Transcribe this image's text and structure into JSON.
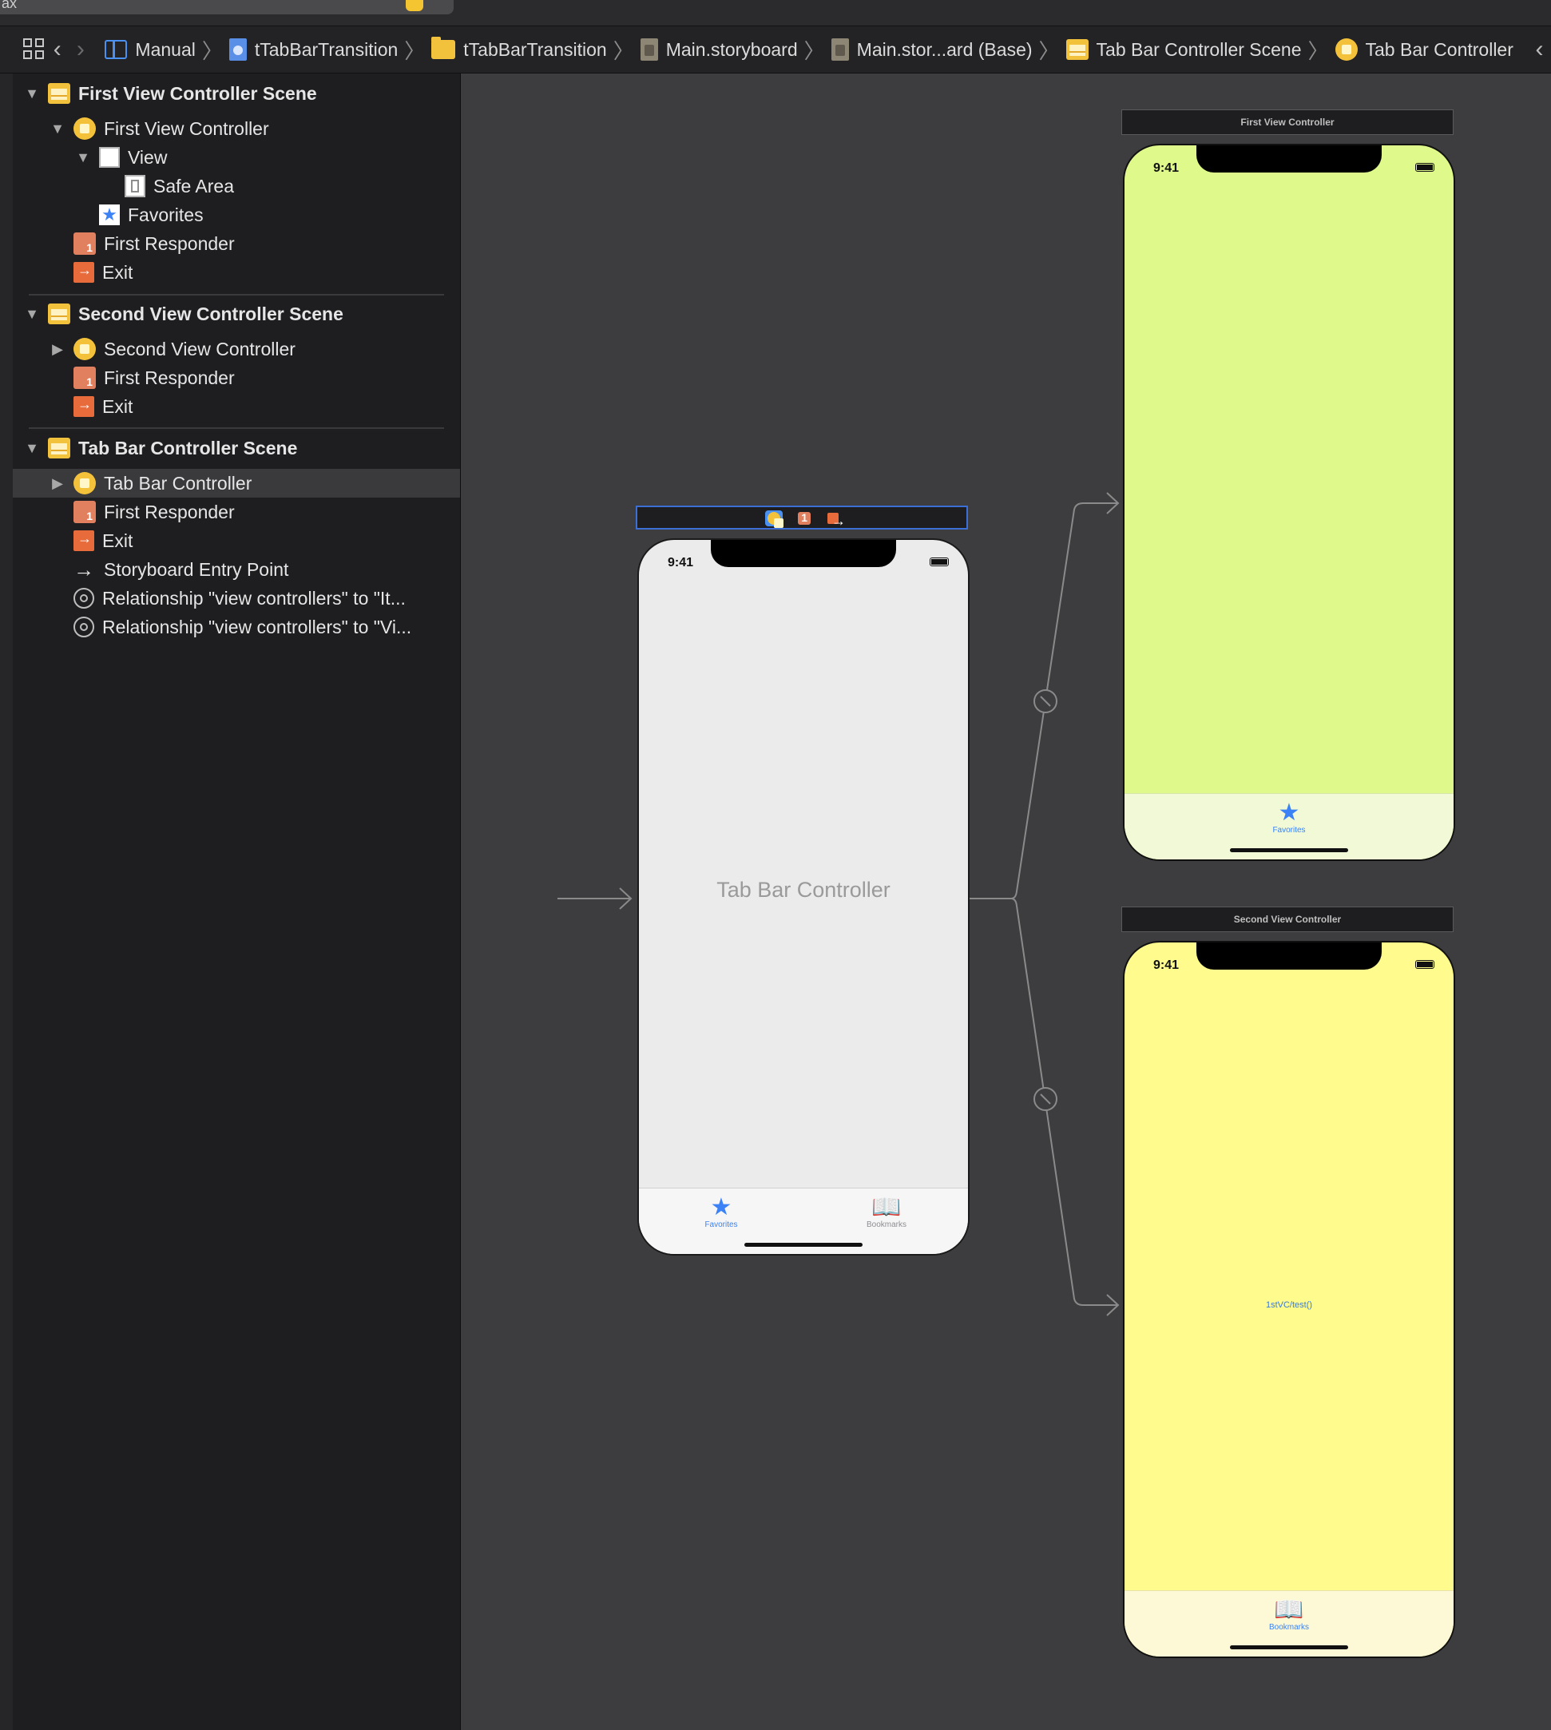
{
  "window": {
    "tab_fragment": "ax"
  },
  "breadcrumb": {
    "items": [
      {
        "label": "Manual",
        "icon": "columns-icon"
      },
      {
        "label": "tTabBarTransition",
        "icon": "project-file-icon"
      },
      {
        "label": "tTabBarTransition",
        "icon": "folder-icon"
      },
      {
        "label": "Main.storyboard",
        "icon": "storyboard-file-icon"
      },
      {
        "label": "Main.stor...ard (Base)",
        "icon": "storyboard-file-icon"
      },
      {
        "label": "Tab Bar Controller Scene",
        "icon": "scene-icon"
      },
      {
        "label": "Tab Bar Controller",
        "icon": "view-controller-icon"
      }
    ]
  },
  "outline": {
    "scene1": {
      "title": "First View Controller Scene",
      "vc": "First View Controller",
      "view": "View",
      "safe_area": "Safe Area",
      "tab_item": "Favorites",
      "responder": "First Responder",
      "exit": "Exit"
    },
    "scene2": {
      "title": "Second View Controller Scene",
      "vc": "Second View Controller",
      "responder": "First Responder",
      "exit": "Exit"
    },
    "scene3": {
      "title": "Tab Bar Controller Scene",
      "vc": "Tab Bar Controller",
      "responder": "First Responder",
      "exit": "Exit",
      "entry": "Storyboard Entry Point",
      "rel1": "Relationship \"view controllers\" to \"It...",
      "rel2": "Relationship \"view controllers\" to \"Vi..."
    }
  },
  "canvas": {
    "tabbar_controller": {
      "title": "Tab Bar Controller",
      "time": "9:41",
      "tabs": [
        {
          "label": "Favorites",
          "icon": "star-icon",
          "color": "#3b82f6"
        },
        {
          "label": "Bookmarks",
          "icon": "book-icon",
          "color": "#8e8e93"
        }
      ]
    },
    "first_vc": {
      "header": "First View Controller",
      "time": "9:41",
      "background": "#dff98a",
      "tab_label": "Favorites"
    },
    "second_vc": {
      "header": "Second View Controller",
      "time": "9:41",
      "background": "#fffb8c",
      "center_label": "1stVC/test()",
      "tab_label": "Bookmarks"
    }
  },
  "colors": {
    "accent": "#3b82f6",
    "sidebar": "#1e1e20",
    "canvas": "#3d3d3f"
  }
}
